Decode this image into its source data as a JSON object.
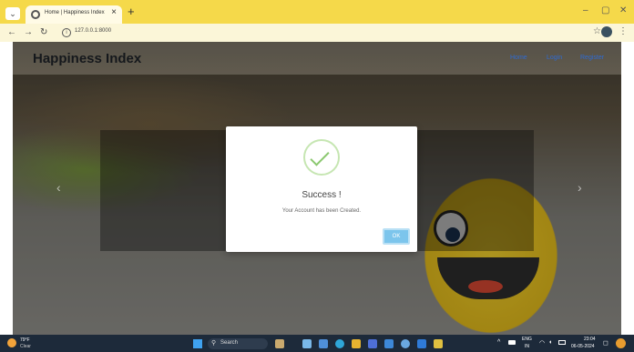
{
  "browser": {
    "tab_title": "Home | Happiness Index",
    "tab_close": "×",
    "new_tab": "+",
    "url": "127.0.0.1:8000",
    "menu_glyph": "⌄",
    "controls": {
      "minimize": "–",
      "maximize": "▢",
      "close": "✕"
    }
  },
  "site": {
    "brand": "Happiness Index",
    "nav": [
      "Home",
      "Login",
      "Register"
    ]
  },
  "carousel": {
    "prev": "‹",
    "next": "›"
  },
  "modal": {
    "title": "Success !",
    "message": "Your Account has been Created.",
    "ok_label": "OK"
  },
  "taskbar": {
    "temperature": "79°F",
    "weather": "Clear",
    "search_placeholder": "Search",
    "language": "ENG",
    "region": "IN",
    "time": "23:04",
    "date": "06-05-2024"
  },
  "colors": {
    "tabstrip": "#f5d94a",
    "brand_text": "#15181c",
    "nav_link": "#2f6bd3",
    "ok_button": "#7cc5ec",
    "success_check": "#8bc870",
    "taskbar": "#1d2a3a"
  }
}
